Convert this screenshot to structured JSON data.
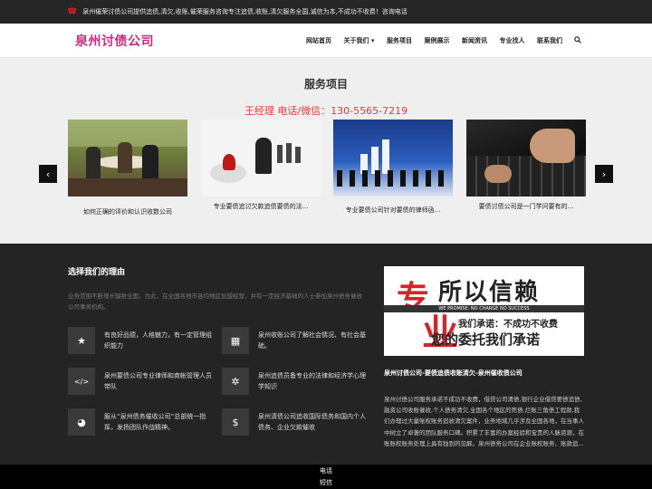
{
  "topbar": {
    "text": "泉州催荣讨债公司提供追债,清欠,收账,催荣服务咨询专注追债,收账,清欠服务全国,诚信为本,不成功不收费！咨询电话"
  },
  "header": {
    "logo": "泉州讨债公司"
  },
  "nav": {
    "items": [
      "网站首页",
      "关于我们 ▾",
      "服务项目",
      "案例展示",
      "新闻资讯",
      "专业找人",
      "联系我们"
    ]
  },
  "services": {
    "title": "服务项目",
    "phone": "王经理 电话/微信：130-5565-7219",
    "cards": [
      {
        "caption": "如何正确的评价和认识收数公司"
      },
      {
        "caption": "专业要债追讨欠款追债要债的法..."
      },
      {
        "caption": "专业要债公司针对要债的律师函..."
      },
      {
        "caption": "要债讨债公司是一门学问要有的..."
      }
    ],
    "prev": "‹",
    "next": "›"
  },
  "why": {
    "title": "选择我们的理由",
    "desc": "业务范围不断增长辐射全国，为此，在全国各地市县均地区加盟经营，并有一定经济基础的人士参加泉州债务催收公司事务机构。",
    "features": [
      {
        "icon": "★",
        "text": "有良好品德，人格魅力，有一定管理组织能力"
      },
      {
        "icon": "▦",
        "text": "泉州收账公司了解社会情况、有社会基础。"
      },
      {
        "icon": "</>",
        "text": "泉州要债公司专业律师和商帐管理人员带队"
      },
      {
        "icon": "✲",
        "text": "泉州追债员备专业的法律和经济学心理学知识"
      },
      {
        "icon": "◕",
        "text": "服从“泉州债务催收公司”总部统一指挥，发扬团队作战精神。"
      },
      {
        "icon": "$",
        "text": "泉州清债公司追收国际债务和国内个人债务、企业欠款催收"
      }
    ]
  },
  "ad": {
    "big1": "专",
    "big2": "业",
    "line1": "所以信赖",
    "banner": "WE PROMISE: NO CHARGE NO SUCCESS",
    "promise": "我们承诺：不成功不收费",
    "line2": "您的委托我们承诺",
    "title": "泉州讨债公司-要债追债收账清欠-泉州催收债公司",
    "text": "泉州讨债公司服务承诺不成功不收费，借贷公司清债,银行企业借贷要债追债,融资公司收账催收,个人债务清欠,全国各个地区的死债,烂账三角债工程款,我们办理过大量账权账务追收清欠案件，业务地域几乎涉及全国各地，在当事人中树立了卓著的团队服务口碑。积累了丰富的办案经验和宝贵的人脉资源，在账账权账务处理上具有独到的见解。泉州债务公司在企业账权账务、账款追..."
  },
  "footer": {
    "line1": "电话",
    "line2": "短信"
  }
}
